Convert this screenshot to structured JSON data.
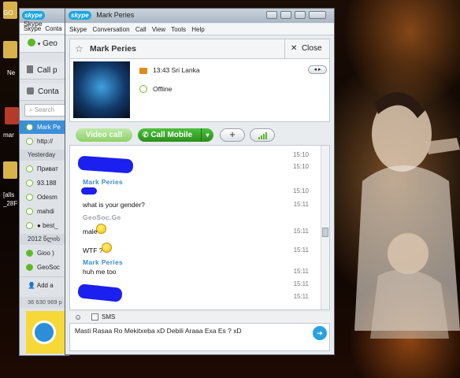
{
  "desktop": {
    "icon_labels": [
      "GO",
      "Ne",
      "mar",
      "[alls",
      "_28F"
    ]
  },
  "back_window": {
    "title": "Skype",
    "menu": [
      "Skype",
      "Conta"
    ],
    "status_text": "Geo",
    "call_label": "Call p",
    "contacts_tab": "Conta",
    "search_placeholder": "Search",
    "selected_contact": "Mark Pe",
    "contacts_top": [
      "http://"
    ],
    "section_yesterday": "Yesterday",
    "contacts_yesterday": [
      "Приват",
      "93.188",
      "Odesm",
      "mahdi",
      "● best_"
    ],
    "section_2012": "2012 წლის",
    "contacts_2012": [
      "Gioo )",
      "GeoSoc"
    ],
    "add_label": "Add a",
    "users_online": "36 630 969 p"
  },
  "front_window": {
    "title": "Mark Peries",
    "menu": [
      "Skype",
      "Conversation",
      "Call",
      "View",
      "Tools",
      "Help"
    ],
    "contact_name": "Mark  Peries",
    "close_label": "Close",
    "local_time": "13:43 Sri Lanka",
    "status": "Offline",
    "video_call_label": "Video call",
    "call_mobile_label": "Call Mobile",
    "add_symbol": "+",
    "messages": [
      {
        "time": "15:10"
      },
      {
        "time": "15:10"
      },
      {
        "sender": "Mark  Peries"
      },
      {
        "time": "15:10"
      },
      {
        "text": "what is your gender?",
        "time": "15:11"
      },
      {
        "sender": "GeoSoc.Ge"
      },
      {
        "text": "male",
        "time": "15:11"
      },
      {
        "text": "WTF ?",
        "time": "15:11"
      },
      {
        "sender": "Mark  Peries"
      },
      {
        "text": "huh me too",
        "time": "15:11"
      },
      {
        "time": "15:11"
      },
      {
        "time": "15:11"
      }
    ],
    "sms_label": "SMS",
    "compose_text": "Masti Rasaa Ro Mekitxeba xD Debili Araaa Exa Es ? xD"
  },
  "colors": {
    "accent_blue": "#3a8ccf",
    "green": "#3fae2a",
    "selection": "#3b8fd9",
    "scribble": "#1b1ff0"
  }
}
